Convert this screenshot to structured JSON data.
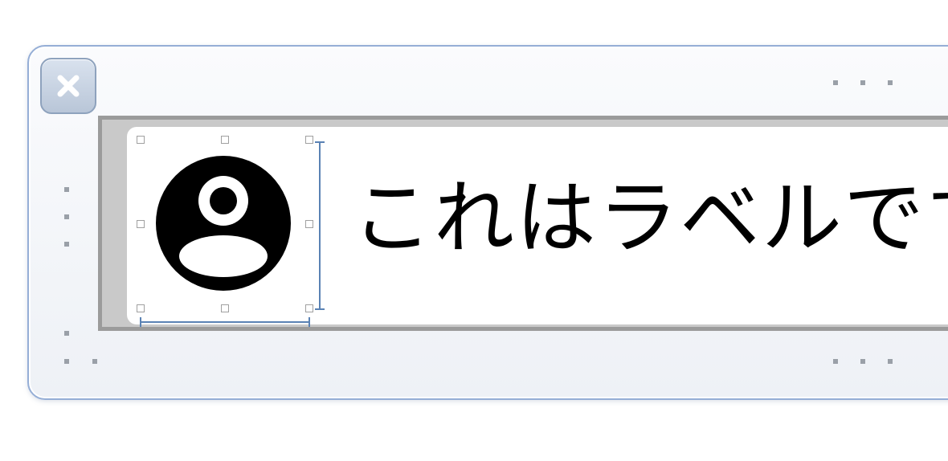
{
  "label": {
    "text": "これはラベルです"
  },
  "icons": {
    "close": "close-icon",
    "avatar": "user-avatar-icon"
  },
  "colors": {
    "frame_border": "#95aed6",
    "container_fill": "#c9c9c9",
    "container_border": "#9b9b9b",
    "guide": "#5a82b4",
    "text": "#000000"
  }
}
